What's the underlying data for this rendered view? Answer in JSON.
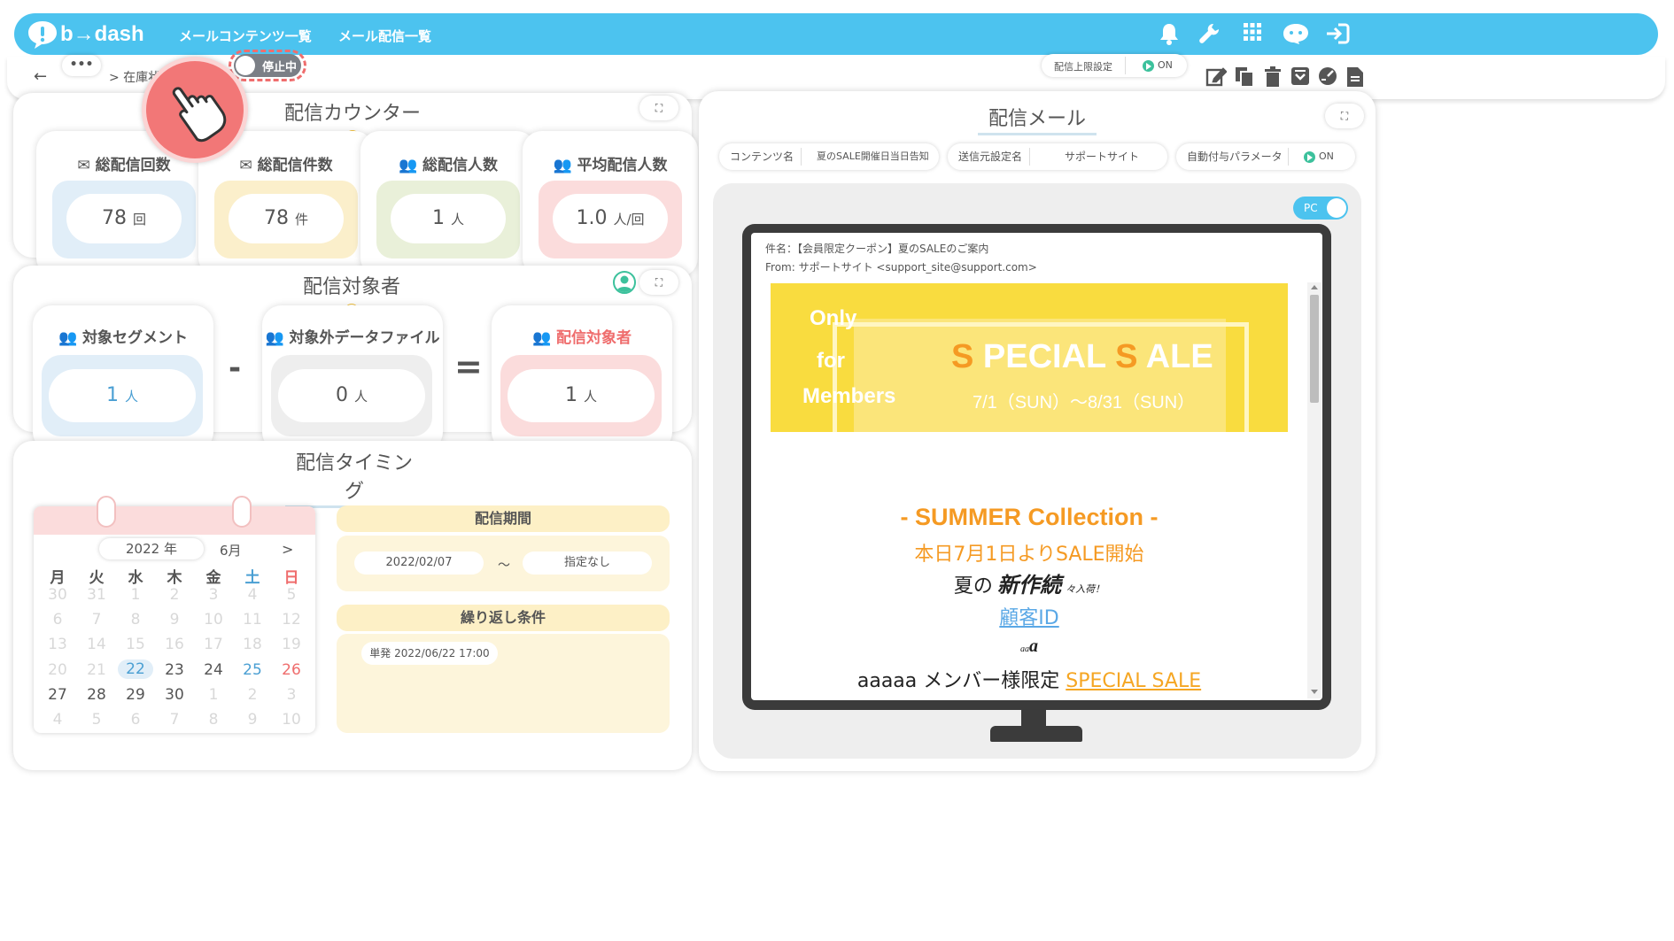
{
  "brand": {
    "logo_text": "b→dash",
    "accent": "#4cc3ef"
  },
  "nav": {
    "item1": "メールコンテンツ一覧",
    "item2": "メール配信一覧"
  },
  "header_icons": [
    "bell-icon",
    "wrench-icon",
    "grid-icon",
    "chat-bot-icon",
    "logout-icon"
  ],
  "subbar": {
    "back": "←",
    "more": "•••",
    "breadcrumb": "> 在庫状況",
    "status_toggle_label": "停止中",
    "limit_label": "配信上限設定",
    "limit_value": "ON",
    "tools": [
      "edit-icon",
      "copy-icon",
      "trash-icon",
      "archive-icon",
      "timer-icon",
      "document-icon"
    ]
  },
  "counter": {
    "title": "配信カウンター",
    "help": "?",
    "expand": "⛶",
    "cards": [
      {
        "label": "総配信回数",
        "value": "78",
        "unit": "回",
        "color": "#e1eef8"
      },
      {
        "label": "総配信件数",
        "value": "78",
        "unit": "件",
        "color": "#fbefcb"
      },
      {
        "label": "総配信人数",
        "value": "1",
        "unit": "人",
        "color": "#e9f0d9"
      },
      {
        "label": "平均配信人数",
        "value": "1.0",
        "unit": "人/回",
        "color": "#fbdcdc"
      }
    ]
  },
  "target": {
    "title": "配信対象者",
    "help": "?",
    "expand": "⛶",
    "cards": [
      {
        "label": "対象セグメント",
        "value": "1",
        "unit": "人"
      },
      {
        "label": "対象外データファイル",
        "value": "0",
        "unit": "人"
      },
      {
        "label": "配信対象者",
        "value": "1",
        "unit": "人"
      }
    ],
    "minus": "-",
    "equals": "="
  },
  "timing": {
    "title": "配信タイミング",
    "calendar": {
      "year": "2022 年",
      "month": "6月",
      "next": ">",
      "weekdays": [
        "月",
        "火",
        "水",
        "木",
        "金",
        "土",
        "日"
      ],
      "rows": [
        [
          "30",
          "31",
          "1",
          "2",
          "3",
          "4",
          "5"
        ],
        [
          "6",
          "7",
          "8",
          "9",
          "10",
          "11",
          "12"
        ],
        [
          "13",
          "14",
          "15",
          "16",
          "17",
          "18",
          "19"
        ],
        [
          "20",
          "21",
          "22",
          "23",
          "24",
          "25",
          "26"
        ],
        [
          "27",
          "28",
          "29",
          "30",
          "1",
          "2",
          "3"
        ],
        [
          "4",
          "5",
          "6",
          "7",
          "8",
          "9",
          "10"
        ]
      ]
    },
    "period_label": "配信期間",
    "period_start": "2022/02/07",
    "period_sep": "～",
    "period_end": "指定なし",
    "repeat_label": "繰り返し条件",
    "repeat_value": "単発 2022/06/22 17:00"
  },
  "mail": {
    "title": "配信メール",
    "expand": "⛶",
    "content_label": "コンテンツ名",
    "content_value": "夏のSALE開催日当日告知",
    "sender_label": "送信元設定名",
    "sender_value": "サポートサイト",
    "param_label": "自動付与パラメータ",
    "param_value": "ON",
    "device_toggle": "PC",
    "subject": "件名：【会員限定クーポン】夏のSALEのご案内",
    "from": "From: サポートサイト <support_site@support.com>",
    "banner": {
      "only": "Only",
      "for": "for",
      "members": "Members",
      "s1": "S",
      "pecial": "PECIAL",
      "s2": "S",
      "ale": "ALE",
      "dates": "7/1（SUN）～8/31（SUN）"
    },
    "body": {
      "collection": "- SUMMER Collection -",
      "start": "本日7月1日よりSALE開始",
      "new1": "夏の",
      "new2": "新作続",
      "new3": "々入荷！",
      "customer_id": "顧客ID",
      "aa_small": "aa",
      "aa_big": "a",
      "last_text": "aaaaa メンバー様限定 ",
      "last_link": "SPECIAL SALE"
    }
  }
}
